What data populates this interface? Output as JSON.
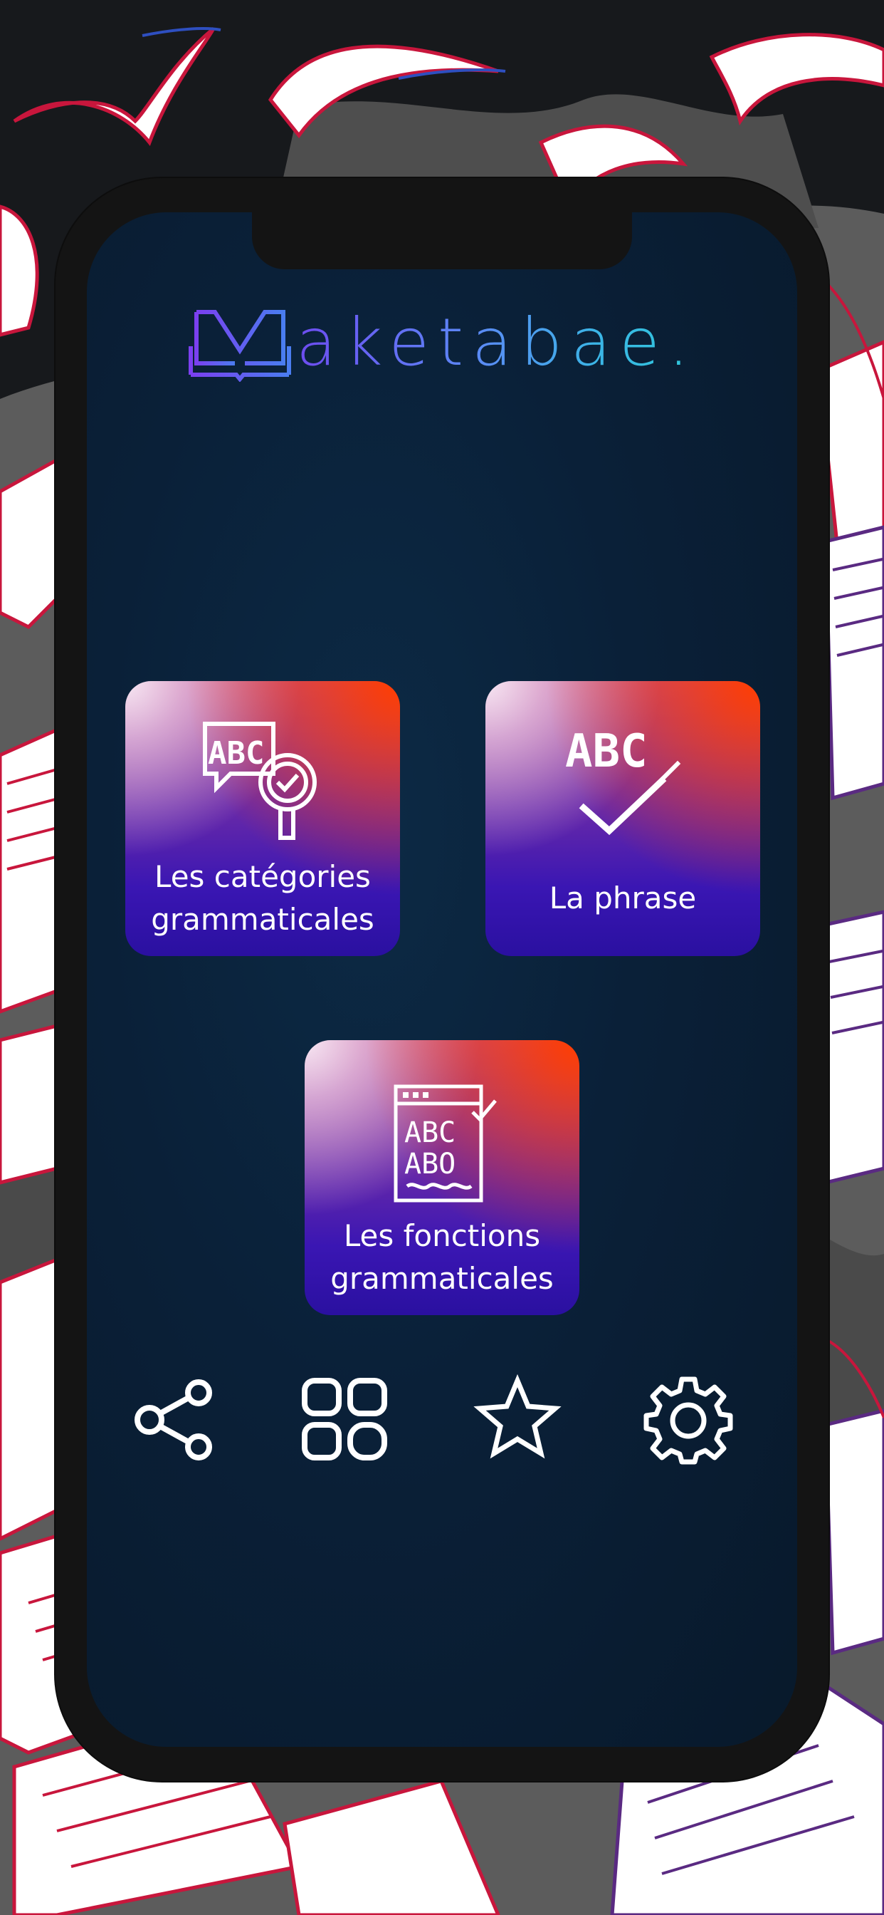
{
  "app": {
    "logo_text": "aketabae."
  },
  "tiles": [
    {
      "label": "Les catégories\ngrammaticales",
      "icon": "abc-magnifier-check-icon"
    },
    {
      "label": "La phrase",
      "icon": "abc-check-pencil-icon"
    },
    {
      "label": "Les fonctions\ngrammaticales",
      "icon": "abc-document-check-icon"
    }
  ],
  "icon_text": {
    "categories": "ABC",
    "phrase": "ABC",
    "doc_line1": "ABC",
    "doc_line2": "ABO"
  },
  "bottom_bar": [
    {
      "icon": "share-icon"
    },
    {
      "icon": "grid-icon"
    },
    {
      "icon": "star-icon"
    },
    {
      "icon": "gear-icon"
    }
  ],
  "colors": {
    "phone_frame": "#141414",
    "screen_bg": "#0a2038",
    "tile_gradient_top_right": "#ff3d00",
    "tile_gradient_bottom": "#2a10a0",
    "logo_gradient_start": "#6d4cf0",
    "logo_gradient_end": "#2fc7d9",
    "backdrop_red": "#c8163c",
    "backdrop_purple": "#5a2a82"
  }
}
